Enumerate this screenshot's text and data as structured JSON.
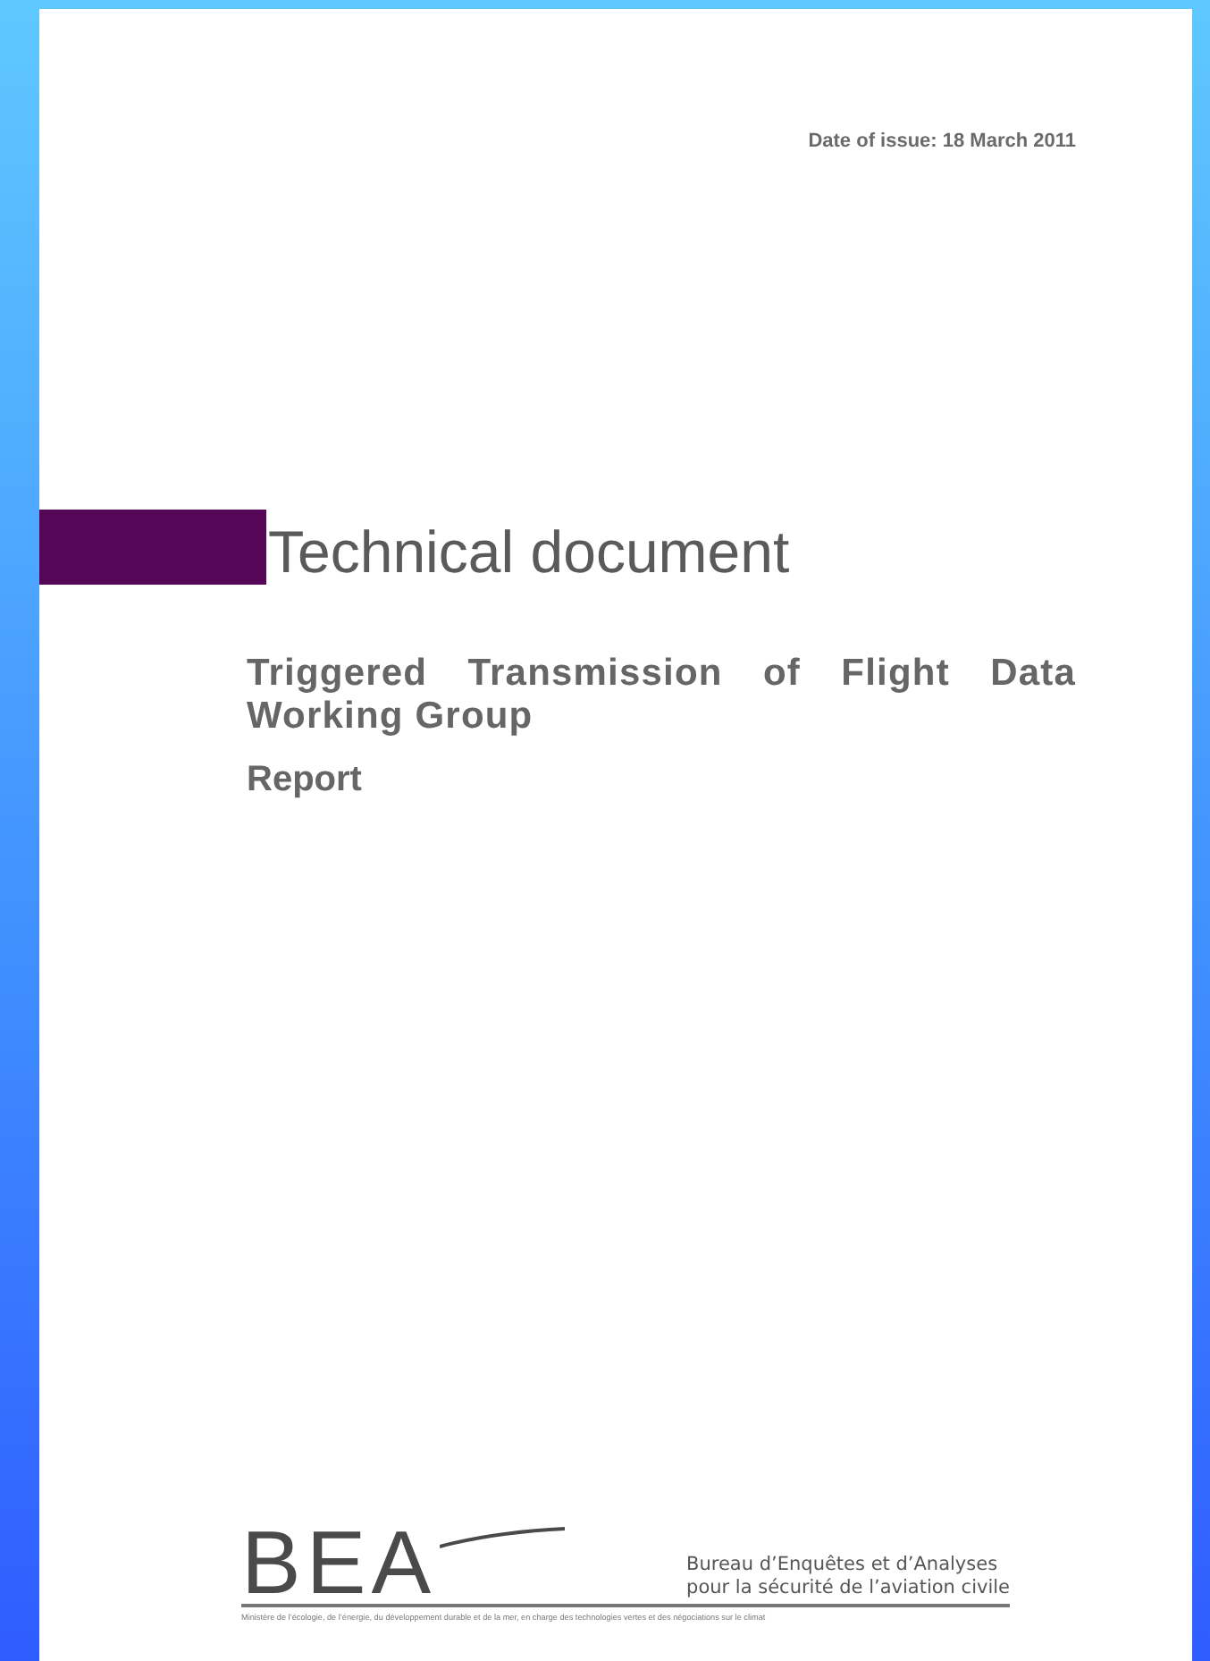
{
  "document": {
    "date_of_issue": "Date of issue: 18 March 2011",
    "category": "Technical document",
    "title": "Triggered Transmission of Flight Data Working Group",
    "subtitle": "Report"
  },
  "footer": {
    "logo": "BEA",
    "agency_lines": [
      "Bureau d’Enquêtes et d’Analyses",
      "pour la sécurité de l’aviation civile"
    ],
    "ministry": "Ministère de l’écologie, de l’énergie, du développement durable et de la mer, en charge des technologies vertes et des négociations sur le climat"
  }
}
